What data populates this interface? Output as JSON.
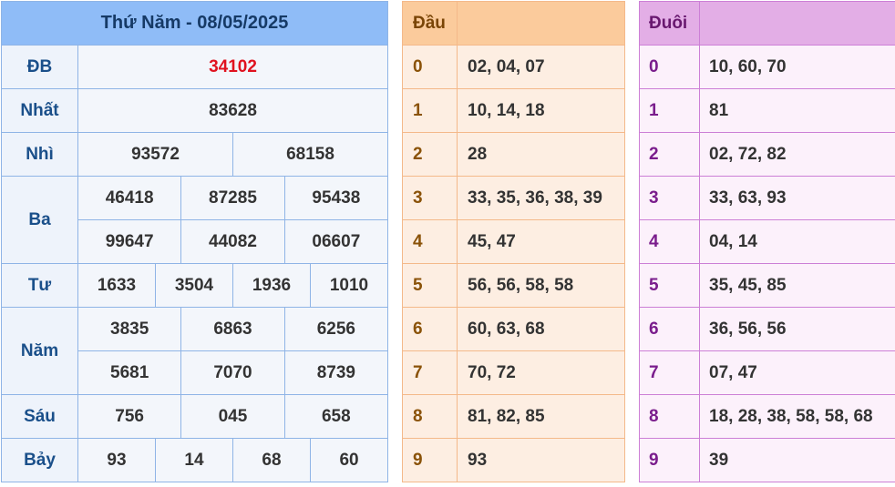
{
  "results": {
    "header": "Thứ Năm - 08/05/2025",
    "db": {
      "label": "ĐB",
      "values": [
        "34102"
      ]
    },
    "nhat": {
      "label": "Nhất",
      "values": [
        "83628"
      ]
    },
    "nhi": {
      "label": "Nhì",
      "values": [
        "93572",
        "68158"
      ]
    },
    "ba": {
      "label": "Ba",
      "values": [
        "46418",
        "87285",
        "95438",
        "99647",
        "44082",
        "06607"
      ]
    },
    "tu": {
      "label": "Tư",
      "values": [
        "1633",
        "3504",
        "1936",
        "1010"
      ]
    },
    "nam": {
      "label": "Năm",
      "values": [
        "3835",
        "6863",
        "6256",
        "5681",
        "7070",
        "8739"
      ]
    },
    "sau": {
      "label": "Sáu",
      "values": [
        "756",
        "045",
        "658"
      ]
    },
    "bay": {
      "label": "Bảy",
      "values": [
        "93",
        "14",
        "68",
        "60"
      ]
    }
  },
  "dau": {
    "header": "Đầu",
    "rows": [
      {
        "key": "0",
        "value": "02, 04, 07"
      },
      {
        "key": "1",
        "value": "10, 14, 18"
      },
      {
        "key": "2",
        "value": "28"
      },
      {
        "key": "3",
        "value": "33, 35, 36, 38, 39"
      },
      {
        "key": "4",
        "value": "45, 47"
      },
      {
        "key": "5",
        "value": "56, 56, 58, 58"
      },
      {
        "key": "6",
        "value": "60, 63, 68"
      },
      {
        "key": "7",
        "value": "70, 72"
      },
      {
        "key": "8",
        "value": "81, 82, 85"
      },
      {
        "key": "9",
        "value": "93"
      }
    ]
  },
  "duoi": {
    "header": "Đuôi",
    "rows": [
      {
        "key": "0",
        "value": "10, 60, 70"
      },
      {
        "key": "1",
        "value": "81"
      },
      {
        "key": "2",
        "value": "02, 72, 82"
      },
      {
        "key": "3",
        "value": "33, 63, 93"
      },
      {
        "key": "4",
        "value": "04, 14"
      },
      {
        "key": "5",
        "value": "35, 45, 85"
      },
      {
        "key": "6",
        "value": "36, 56, 56"
      },
      {
        "key": "7",
        "value": "07, 47"
      },
      {
        "key": "8",
        "value": "18, 28, 38, 58, 58, 68"
      },
      {
        "key": "9",
        "value": "39"
      }
    ]
  },
  "colors": {
    "results_header_bg": "#8fbcf7",
    "special_prize": "#e0121f",
    "dau_header_bg": "#fbcb9c",
    "duoi_header_bg": "#e3aee6"
  }
}
